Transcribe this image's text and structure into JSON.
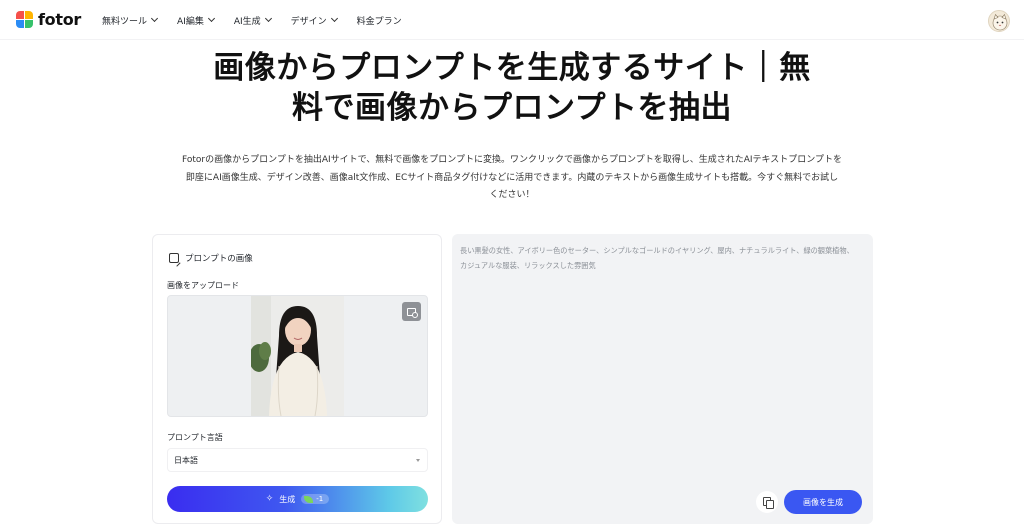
{
  "brand": {
    "name": "fotor",
    "colors": [
      "#f5504a",
      "#ffb400",
      "#2b8cf5",
      "#36c26b"
    ]
  },
  "nav": {
    "items": [
      {
        "label": "無料ツール",
        "has_dropdown": true
      },
      {
        "label": "AI編集",
        "has_dropdown": true
      },
      {
        "label": "AI生成",
        "has_dropdown": true
      },
      {
        "label": "デザイン",
        "has_dropdown": true
      },
      {
        "label": "料金プラン",
        "has_dropdown": false
      }
    ]
  },
  "hero": {
    "title_line1": "画像からプロンプトを生成するサイト｜無",
    "title_line2": "料で画像からプロンプトを抽出",
    "desc_line1": "Fotorの画像からプロンプトを抽出AIサイトで、無料で画像をプロンプトに変換。ワンクリックで画像からプロンプトを取得し、生成されたAIテキストプロンプトを",
    "desc_line2": "即座にAI画像生成、デザイン改善、画像alt文作成、ECサイト商品タグ付けなどに活用できます。内蔵のテキストから画像生成サイトも搭載。今すぐ無料でお試し",
    "desc_line3": "ください！"
  },
  "left_panel": {
    "heading": "プロンプトの画像",
    "upload_label": "画像をアップロード",
    "language_label": "プロンプト言語",
    "language_value": "日本語",
    "generate_label": "生成",
    "credit_cost": "-1"
  },
  "right_panel": {
    "result_text": "長い黒髪の女性、アイボリー色のセーター、シンプルなゴールドのイヤリング、屋内、ナチュラルライト、緑の観葉植物、カジュアルな服装、リラックスした雰囲気",
    "image_gen_label": "画像を生成"
  },
  "accent_color": "#3a57f2"
}
